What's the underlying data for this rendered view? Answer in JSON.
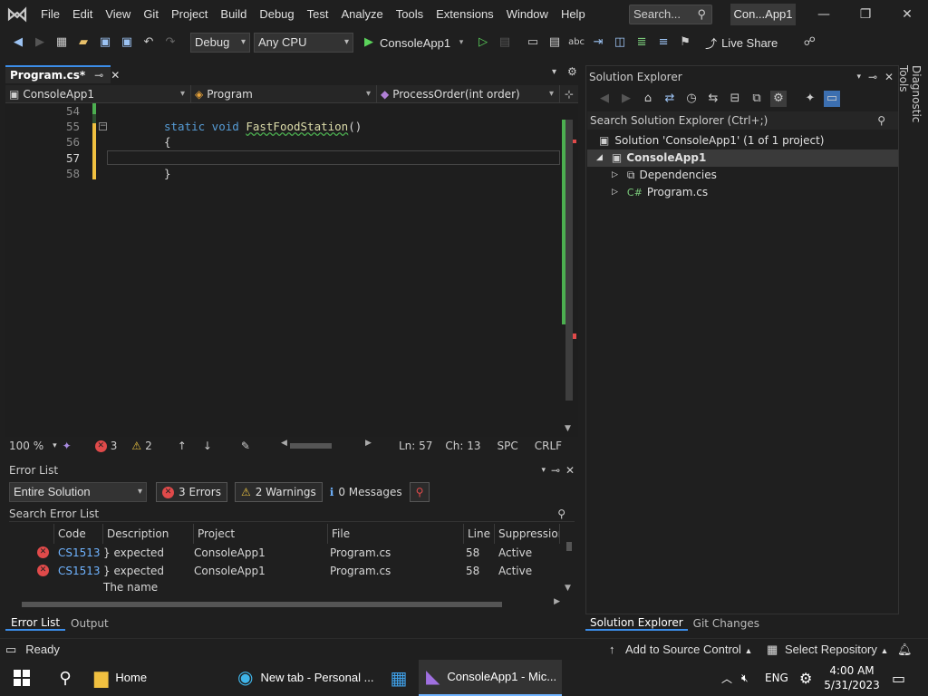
{
  "menu": [
    "File",
    "Edit",
    "View",
    "Git",
    "Project",
    "Build",
    "Debug",
    "Test",
    "Analyze",
    "Tools",
    "Extensions",
    "Window",
    "Help"
  ],
  "search": {
    "placeholder": "Search..."
  },
  "solution_badge": "Con...App1",
  "toolbar": {
    "config": "Debug",
    "platform": "Any CPU",
    "run_target": "ConsoleApp1",
    "live_share": "Live Share"
  },
  "editor": {
    "tab_label": "Program.cs*",
    "nav": {
      "project": "ConsoleApp1",
      "type": "Program",
      "member": "ProcessOrder(int order)"
    },
    "lines": [
      {
        "num": "54",
        "code": ""
      },
      {
        "num": "55",
        "kw": "static void ",
        "fn": "FastFoodStation",
        "rest": "()"
      },
      {
        "num": "56",
        "code": "{"
      },
      {
        "num": "57",
        "code": ""
      },
      {
        "num": "58",
        "code": "}"
      }
    ],
    "status": {
      "zoom": "100 %",
      "errors": "3",
      "warnings": "2",
      "ln": "Ln: 57",
      "ch": "Ch: 13",
      "spc": "SPC",
      "crlf": "CRLF"
    }
  },
  "error_list": {
    "title": "Error List",
    "scope": "Entire Solution",
    "errors_btn": "3 Errors",
    "warnings_btn": "2 Warnings",
    "messages_btn": "0 Messages",
    "search_placeholder": "Search Error List",
    "columns": [
      "Code",
      "Description",
      "Project",
      "File",
      "Line",
      "Suppression S"
    ],
    "rows": [
      {
        "code": "CS1513",
        "description": "} expected",
        "project": "ConsoleApp1",
        "file": "Program.cs",
        "line": "58",
        "suppression": "Active"
      },
      {
        "code": "CS1513",
        "description": "} expected",
        "project": "ConsoleApp1",
        "file": "Program.cs",
        "line": "58",
        "suppression": "Active"
      },
      {
        "code": "",
        "description": "The name",
        "project": "",
        "file": "",
        "line": "",
        "suppression": ""
      }
    ],
    "bottom_tabs": [
      "Error List",
      "Output"
    ]
  },
  "solution_explorer": {
    "title": "Solution Explorer",
    "search_placeholder": "Search Solution Explorer (Ctrl+;)",
    "solution": "Solution 'ConsoleApp1' (1 of 1 project)",
    "project": "ConsoleApp1",
    "children": [
      "Dependencies",
      "Program.cs"
    ],
    "bottom_tabs": [
      "Solution Explorer",
      "Git Changes"
    ],
    "side_tab": "Diagnostic Tools"
  },
  "statusbar": {
    "ready": "Ready",
    "source_control": "Add to Source Control",
    "repo": "Select Repository"
  },
  "taskbar": {
    "home": "Home",
    "edge": "New tab - Personal ...",
    "vs": "ConsoleApp1 - Mic...",
    "lang": "ENG",
    "time": "4:00 AM",
    "date": "5/31/2023"
  }
}
